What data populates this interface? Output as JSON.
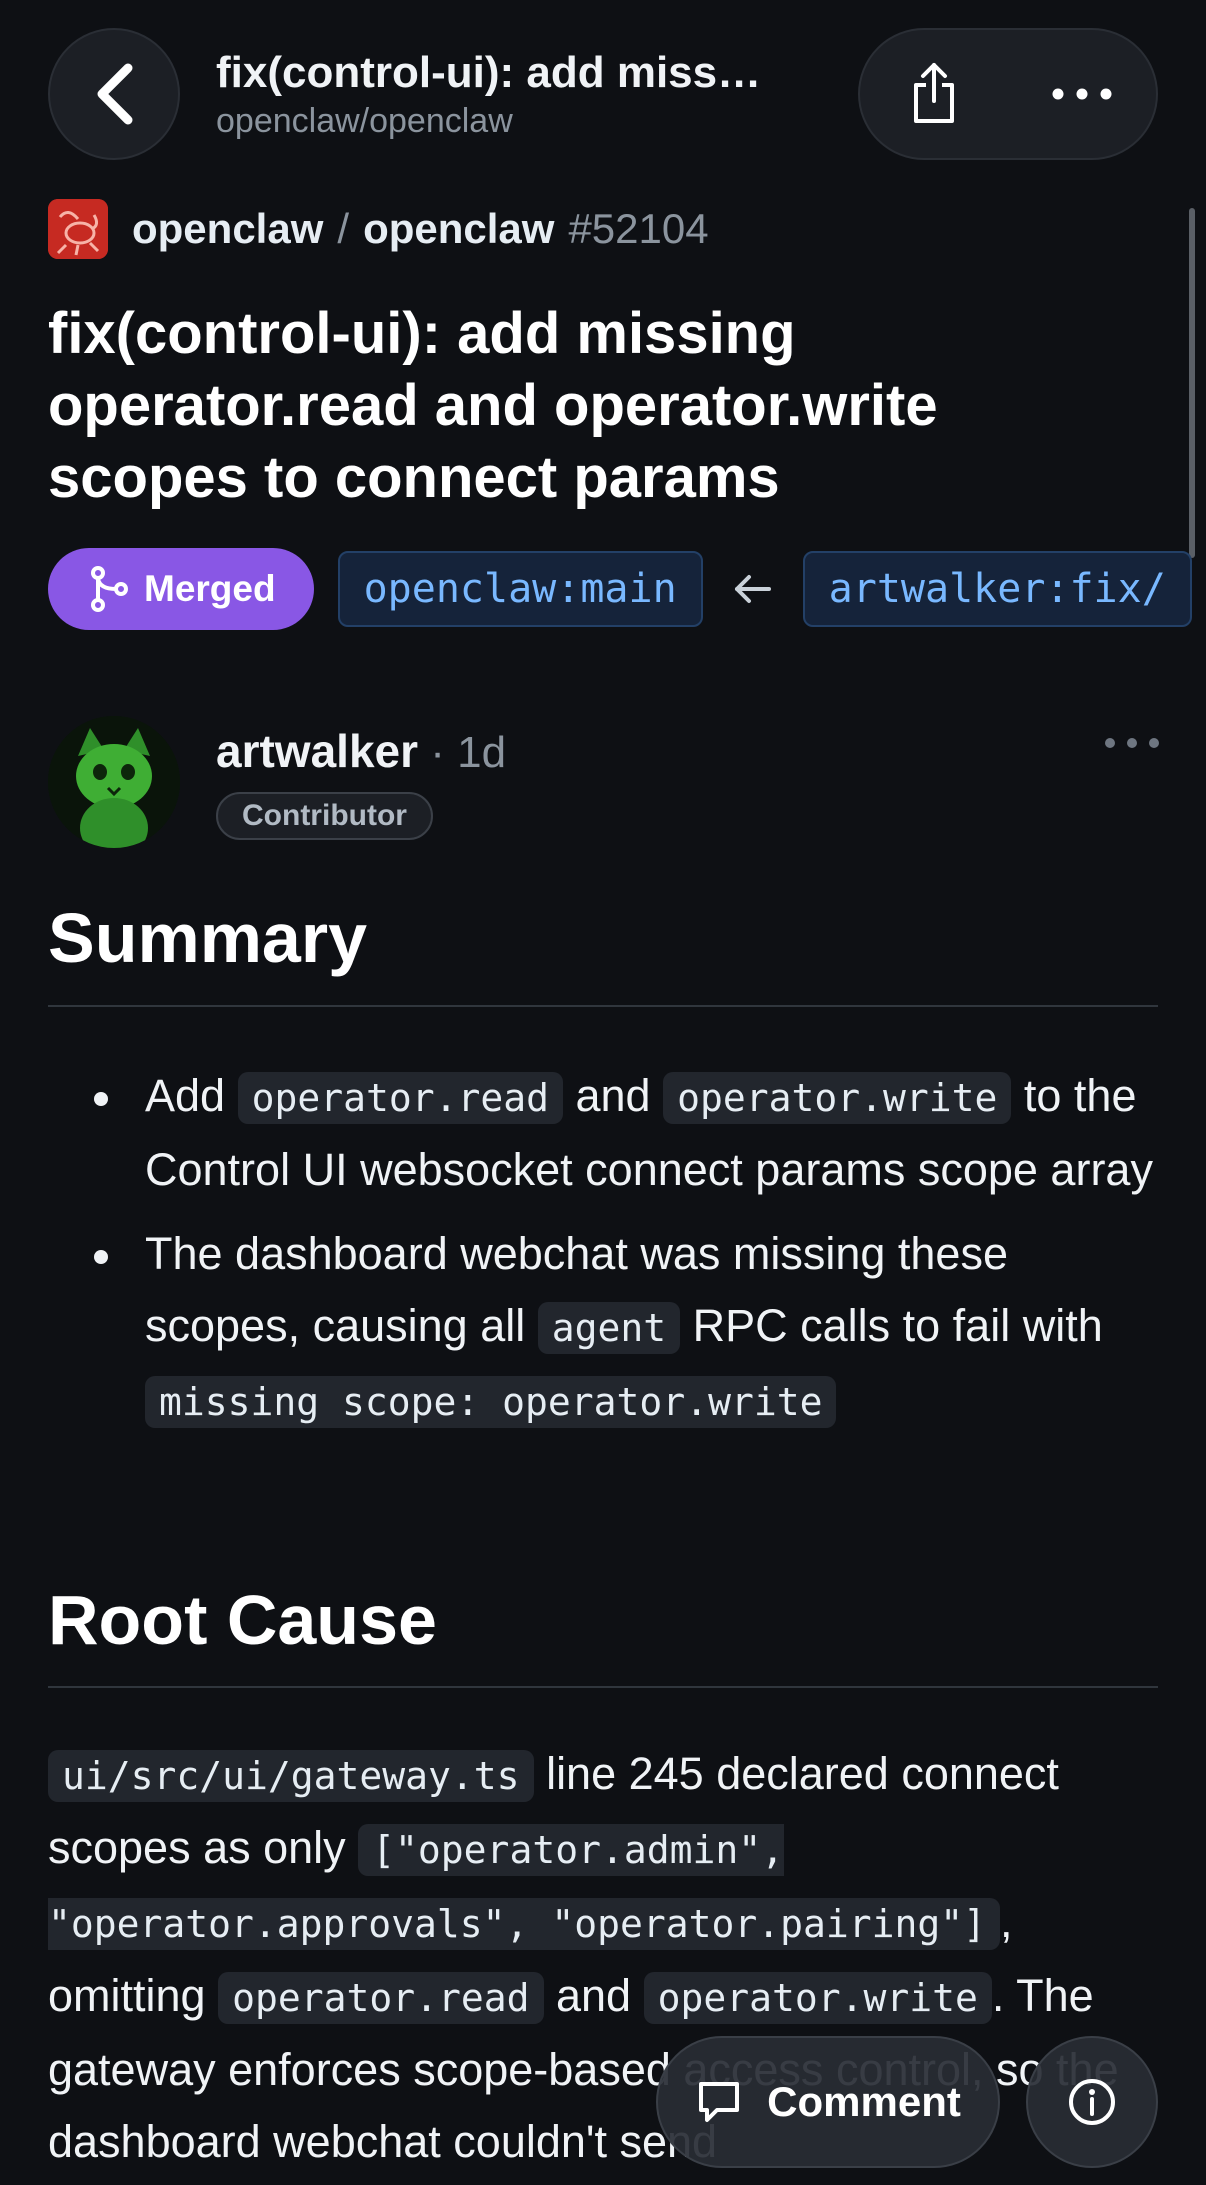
{
  "header": {
    "title": "fix(control-ui): add miss…",
    "subtitle": "openclaw/openclaw"
  },
  "repo": {
    "owner": "openclaw",
    "separator": "/",
    "name": "openclaw",
    "number": "#52104"
  },
  "pr": {
    "title": "fix(control-ui): add missing operator.read and operator.write scopes to connect params",
    "status": "Merged",
    "base_branch": "openclaw:main",
    "head_branch": "artwalker:fix/"
  },
  "comment": {
    "author": "artwalker",
    "time": " · 1d",
    "role": "Contributor"
  },
  "body": {
    "summary_heading": "Summary",
    "bullet1": {
      "t1": "Add ",
      "c1": "operator.read",
      "t2": " and ",
      "c2": "operator.write",
      "t3": " to the Control UI websocket connect params scope array"
    },
    "bullet2": {
      "t1": "The dashboard webchat was missing these scopes, causing all ",
      "c1": "agent",
      "t2": " RPC calls to fail with ",
      "c2": "missing scope: operator.write"
    },
    "root_heading": "Root Cause",
    "root": {
      "c1": "ui/src/ui/gateway.ts",
      "t1": " line 245 declared connect scopes as only ",
      "c2": "[\"operator.admin\", \"operator.approvals\", \"operator.pairing\"]",
      "t2": ", omitting ",
      "c3": "operator.read",
      "t3": " and ",
      "c4": "operator.write",
      "t4": ". The gateway enforces scope-based access control, so the dashboard webchat couldn't send"
    }
  },
  "actions": {
    "comment_label": "Comment"
  },
  "colors": {
    "background": "#0e1014",
    "merged": "#8957e5",
    "branch_text": "#79b8ff"
  },
  "icons": [
    "chevron-left-icon",
    "share-icon",
    "more-horizontal-icon",
    "merge-icon",
    "arrow-left-icon",
    "comment-icon",
    "info-icon"
  ]
}
